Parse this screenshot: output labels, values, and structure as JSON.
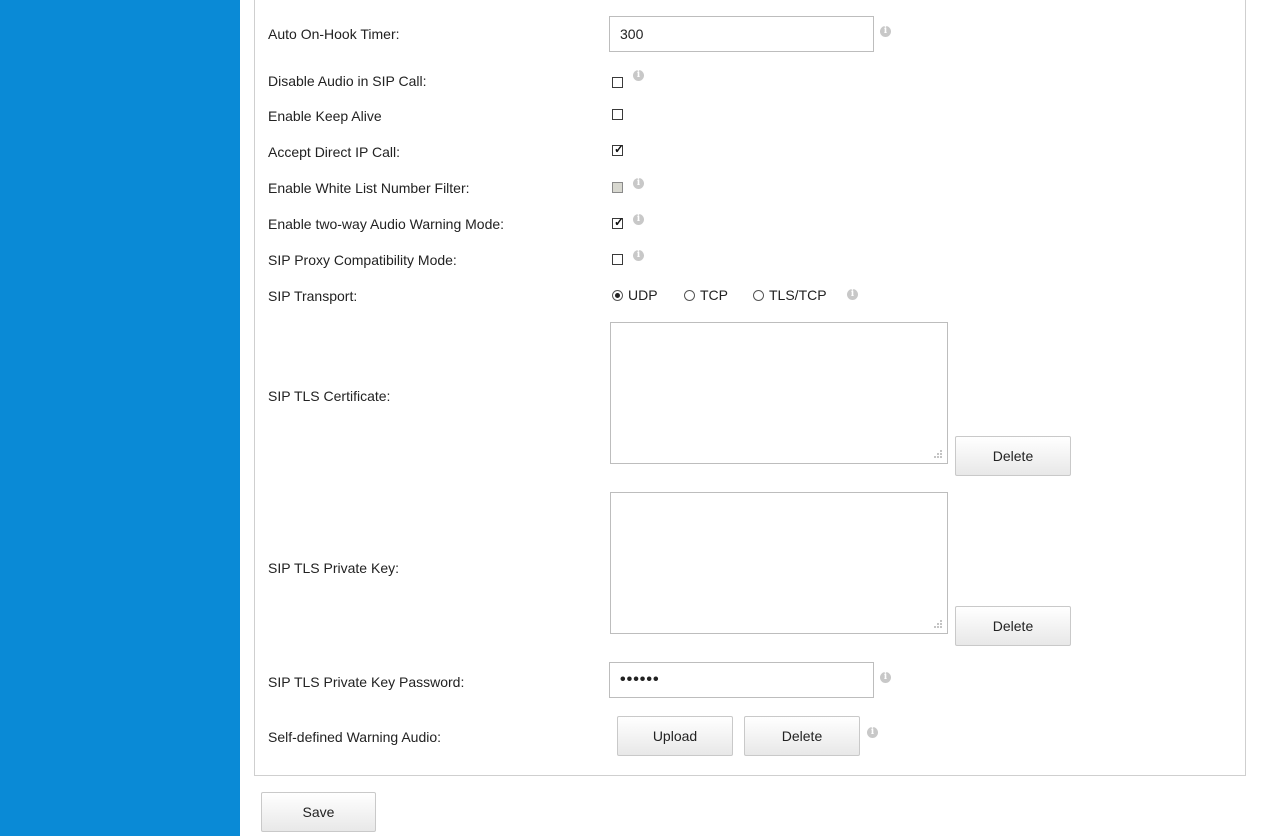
{
  "form": {
    "auto_on_hook_timer": {
      "label": "Auto On-Hook Timer:",
      "value": "300"
    },
    "disable_audio_sip_call": {
      "label": "Disable Audio in SIP Call:",
      "checked": false
    },
    "enable_keep_alive": {
      "label": "Enable Keep Alive",
      "checked": false
    },
    "accept_direct_ip_call": {
      "label": "Accept Direct IP Call:",
      "checked": true
    },
    "enable_white_list_filter": {
      "label": "Enable White List Number Filter:",
      "checked": false,
      "disabled": true
    },
    "two_way_audio_warning": {
      "label": "Enable two-way Audio Warning Mode:",
      "checked": true
    },
    "sip_proxy_compat": {
      "label": "SIP Proxy Compatibility Mode:",
      "checked": false
    },
    "sip_transport": {
      "label": "SIP Transport:",
      "options": [
        "UDP",
        "TCP",
        "TLS/TCP"
      ],
      "selected": "UDP"
    },
    "sip_tls_certificate": {
      "label": "SIP TLS Certificate:",
      "value": "",
      "delete_label": "Delete"
    },
    "sip_tls_private_key": {
      "label": "SIP TLS Private Key:",
      "value": "",
      "delete_label": "Delete"
    },
    "sip_tls_key_password": {
      "label": "SIP TLS Private Key Password:",
      "masked_value": "••••••"
    },
    "self_defined_warning_audio": {
      "label": "Self-defined Warning Audio:",
      "upload_label": "Upload",
      "delete_label": "Delete"
    }
  },
  "actions": {
    "save_label": "Save"
  },
  "icons": {
    "info": "info-icon",
    "resize": "resize-grip-icon"
  },
  "colors": {
    "sidebar": "#0a8ad6"
  }
}
